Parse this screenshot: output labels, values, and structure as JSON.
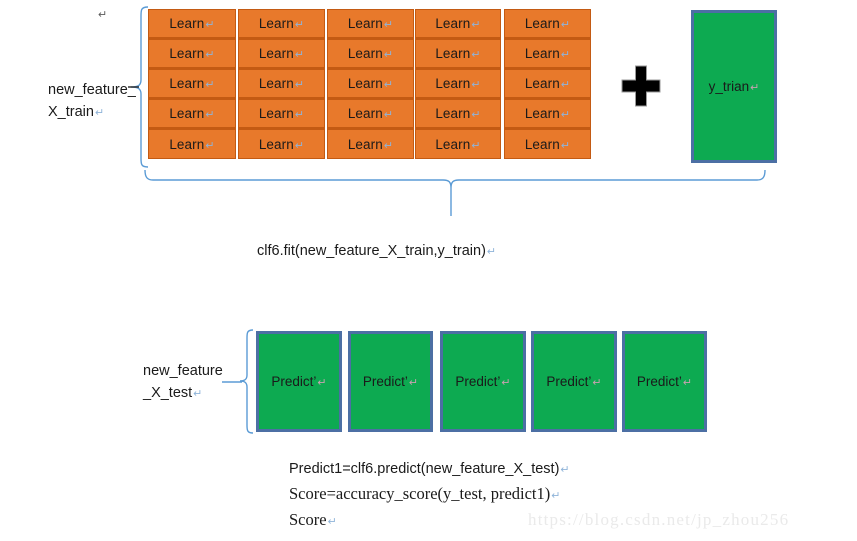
{
  "colors": {
    "learner_fill": "#E8792B",
    "learner_border": "#C35A13",
    "green_fill": "#0DAA51",
    "green_border": "#4C6FA4",
    "brace_stroke": "#5B9BD5",
    "plus_fill": "#000000",
    "watermark": "#EAEAEA",
    "text": "#1A1A1A"
  },
  "top_marks": {
    "stray_pilcrow": "↵"
  },
  "train_section": {
    "left_label_line1": "new_feature_",
    "left_label_line2": "X_train",
    "left_label_pilcrow": "↵",
    "learner_grid": {
      "columns": 5,
      "rows": 5,
      "cell_label": "Learn",
      "cell_pilcrow": "↵"
    },
    "operator": "plus",
    "target_box": {
      "label": "y_trian",
      "pilcrow": "↵"
    },
    "fit_call": "clf6.fit(new_feature_X_train,y_train)",
    "fit_call_pilcrow": "↵"
  },
  "test_section": {
    "left_label_line1": "new_feature",
    "left_label_line2": "_X_test",
    "left_label_pilcrow": "↵",
    "predict_boxes": {
      "count": 5,
      "label": "Predict’",
      "pilcrow": "↵"
    },
    "code_lines": [
      {
        "text": "Predict1=clf6.predict(new_feature_X_test)",
        "pilcrow": "↵",
        "font": "sans"
      },
      {
        "text": "Score=accuracy_score(y_test, predict1)",
        "pilcrow": "↵",
        "font": "serif"
      },
      {
        "text": "Score",
        "pilcrow": "↵",
        "font": "serif"
      }
    ]
  },
  "watermark": {
    "text": "https://blog.csdn.net/jp_zhou256"
  }
}
